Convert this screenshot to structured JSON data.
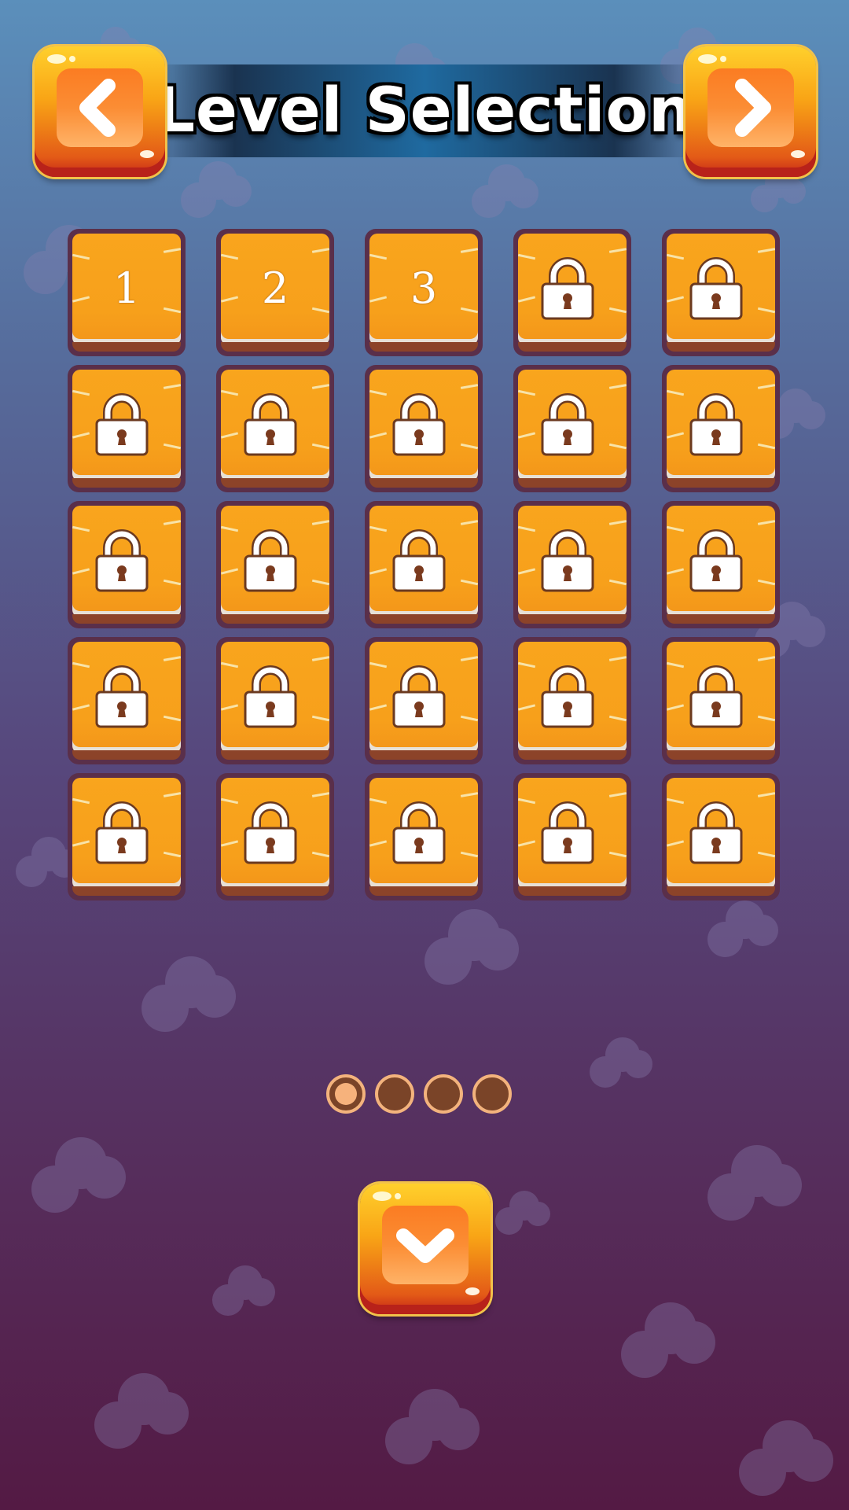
{
  "header": {
    "title": "Level Selection",
    "prev_icon": "chevron-left-icon",
    "next_icon": "chevron-right-icon"
  },
  "levels": [
    {
      "label": "1",
      "locked": false
    },
    {
      "label": "2",
      "locked": false
    },
    {
      "label": "3",
      "locked": false
    },
    {
      "label": "",
      "locked": true
    },
    {
      "label": "",
      "locked": true
    },
    {
      "label": "",
      "locked": true
    },
    {
      "label": "",
      "locked": true
    },
    {
      "label": "",
      "locked": true
    },
    {
      "label": "",
      "locked": true
    },
    {
      "label": "",
      "locked": true
    },
    {
      "label": "",
      "locked": true
    },
    {
      "label": "",
      "locked": true
    },
    {
      "label": "",
      "locked": true
    },
    {
      "label": "",
      "locked": true
    },
    {
      "label": "",
      "locked": true
    },
    {
      "label": "",
      "locked": true
    },
    {
      "label": "",
      "locked": true
    },
    {
      "label": "",
      "locked": true
    },
    {
      "label": "",
      "locked": true
    },
    {
      "label": "",
      "locked": true
    },
    {
      "label": "",
      "locked": true
    },
    {
      "label": "",
      "locked": true
    },
    {
      "label": "",
      "locked": true
    },
    {
      "label": "",
      "locked": true
    },
    {
      "label": "",
      "locked": true
    }
  ],
  "pagination": {
    "pages": 4,
    "current": 1
  },
  "footer": {
    "icon": "chevron-down-icon"
  },
  "colors": {
    "tile": "#f9a51d",
    "tile_border": "#5a2f4a",
    "button_orange": "#fb7c22",
    "dot_active": "#f6b27c",
    "dot_inactive": "#7a4428"
  }
}
